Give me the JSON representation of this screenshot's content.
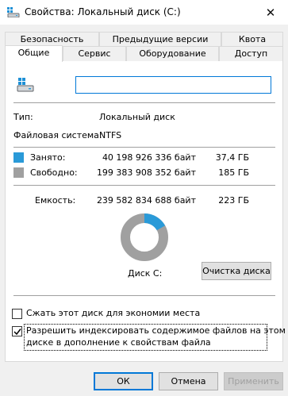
{
  "window": {
    "title": "Свойства: Локальный диск (C:)",
    "close_glyph": "✕",
    "icon": "drive-icon"
  },
  "tabs": {
    "back_row": [
      "Безопасность",
      "Предыдущие версии",
      "Квота"
    ],
    "front_row": [
      "Общие",
      "Сервис",
      "Оборудование",
      "Доступ"
    ],
    "active": "Общие"
  },
  "general": {
    "drive_name_value": "",
    "type_label": "Тип:",
    "type_value": "Локальный диск",
    "fs_label": "Файловая система:",
    "fs_value": "NTFS",
    "used_label": "Занято:",
    "used_bytes": "40 198 926 336 байт",
    "used_size": "37,4 ГБ",
    "free_label": "Свободно:",
    "free_bytes": "199 383 908 352 байт",
    "free_size": "185 ГБ",
    "capacity_label": "Емкость:",
    "capacity_bytes": "239 582 834 688 байт",
    "capacity_size": "223 ГБ",
    "disk_label": "Диск C:",
    "cleanup_button": "Очистка диска",
    "compress_label": "Сжать этот диск для экономии места",
    "compress_checked": false,
    "index_label_line1": "Разрешить индексировать содержимое файлов на этом",
    "index_label_line2": "диске в дополнение к свойствам файла",
    "index_checked": true
  },
  "colors": {
    "used": "#2a9ad8",
    "free": "#a0a0a0"
  },
  "buttons": {
    "ok": "ОК",
    "cancel": "Отмена",
    "apply": "Применить"
  }
}
